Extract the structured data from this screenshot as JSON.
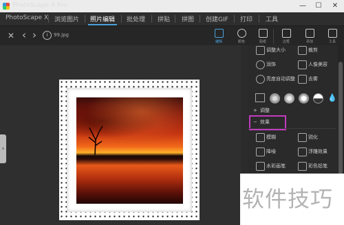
{
  "app": {
    "title": "PhotoScape X Pro"
  },
  "window_controls": {
    "minimize": "—",
    "maximize": "☐",
    "close": "✕"
  },
  "menu": [
    {
      "label": "PhotoScape X"
    },
    {
      "label": "浏览图片"
    },
    {
      "label": "照片编辑",
      "active": true
    },
    {
      "label": "批处理"
    },
    {
      "label": "拼贴"
    },
    {
      "label": "拼图"
    },
    {
      "label": "创建GIF"
    },
    {
      "label": "打印"
    },
    {
      "label": "工具"
    }
  ],
  "toolbar": {
    "close": "✕",
    "back": "‹",
    "forward": "›",
    "info": "i",
    "filename": "99.jpg",
    "right_buttons": [
      {
        "label": "编辑",
        "icon": "edit-icon",
        "active": true
      },
      {
        "label": "颜色",
        "icon": "color-icon"
      },
      {
        "label": "贴纸",
        "icon": "sticker-icon"
      },
      {
        "label": "边框",
        "icon": "frame-icon"
      },
      {
        "label": "添加",
        "icon": "add-icon"
      },
      {
        "label": "工具",
        "icon": "tools-icon"
      }
    ]
  },
  "panel": {
    "top_items": [
      {
        "label": "调整大小"
      },
      {
        "label": "裁剪"
      },
      {
        "label": "润饰"
      },
      {
        "label": "人像美容"
      },
      {
        "label": "亮度自动调整"
      },
      {
        "label": "去雾"
      }
    ],
    "adjust_label": "调整",
    "effects_label": "效果",
    "effect_items": [
      {
        "label": "模糊"
      },
      {
        "label": "锐化"
      },
      {
        "label": "降噪"
      },
      {
        "label": "浮雕效果"
      },
      {
        "label": "水彩画笔"
      },
      {
        "label": "彩色铅笔"
      }
    ]
  },
  "watermark": "软件技巧",
  "colors": {
    "accent": "#4aa3df",
    "highlight": "#c23bc0"
  }
}
